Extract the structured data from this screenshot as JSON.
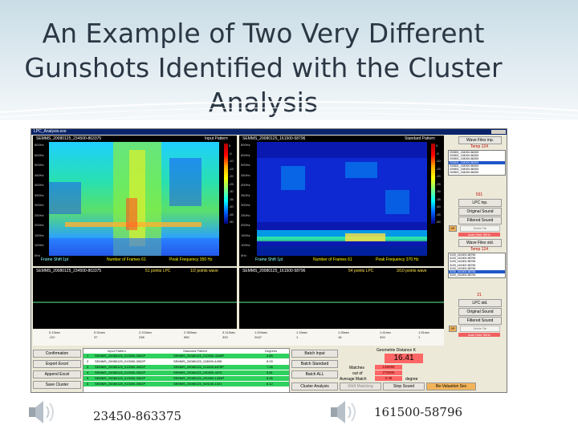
{
  "slide": {
    "title": "An Example of Two Very Different\nGunshots Identified with the Cluster\nAnalysis",
    "caption_left": "23450-863375",
    "caption_right": "161500-58796"
  },
  "window": {
    "title": "LPC_Analysis.exe",
    "input_pane": {
      "file": "SEMMS_20080125_234500-863375",
      "label": "Input Pattern",
      "freq_ticks": [
        "800Hz",
        "600Hz",
        "500Hz",
        "450Hz",
        "400Hz",
        "350Hz",
        "300Hz",
        "250Hz",
        "200Hz",
        "150Hz",
        "100Hz",
        "0Hz"
      ],
      "footer_frame": "Frame Shift 1pt",
      "footer_frames": "Number of Frames 61",
      "footer_peak": "Peak Frequency 350 Hz"
    },
    "standard_pane": {
      "file": "SEMMS_20080125_161500-58796",
      "label": "Standard Pattern",
      "freq_ticks": [
        "800Hz",
        "600Hz",
        "500Hz",
        "450Hz",
        "400Hz",
        "350Hz",
        "300Hz",
        "250Hz",
        "200Hz",
        "150Hz",
        "100Hz",
        "0Hz"
      ],
      "footer_frame": "Frame Shift 1pt",
      "footer_frames": "Number of Frames 61",
      "footer_peak": "Peak Frequency 370 Hz"
    },
    "colorbar_ticks": [
      "0",
      "-5",
      "-10",
      "-15",
      "-20",
      "-25",
      "-30",
      "-35",
      "-40",
      "-45",
      "-50"
    ],
    "wave_left": {
      "file": "SEMMS_20080125_234500-863375",
      "points": "51 points LPC",
      "mode": "1/2 points wave",
      "ticks": [
        "0.13sec",
        "0.91sec",
        "2.113sec",
        "2.350sec",
        "3.113sec"
      ],
      "sub": [
        "-22+",
        "37",
        "238",
        "550",
        "320"
      ]
    },
    "wave_right": {
      "file": "SEMMS_20080125_161500-58796",
      "points": "54 points LPC",
      "mode": "3/10 points wave",
      "ticks": [
        "1.024sec",
        "1.15sec",
        "1.26sec",
        "1.41sec",
        "1.51sec"
      ],
      "sub": [
        "2047",
        "1",
        "16",
        "320",
        "1"
      ]
    },
    "right_panel": {
      "wave_files_inp": "Wave Files inp.",
      "temp_inp": "Temp 124",
      "files_inp": [
        "200801_154000-86305",
        "200801_154000-86305",
        "200801_154000-86305",
        "200801_154000-86305",
        "200801_154000-86305",
        "200801_154000-86305",
        "200801_154000-86305"
      ],
      "num_inp": "531",
      "lpc_inp": "LPC inp.",
      "original_sound": "Original Sound",
      "filtered_sound": "Filtered Sound",
      "delete_file": "Delete File",
      "auto": "Auto",
      "hide": "Hide",
      "hz": "50Hz",
      "wave_files_std": "Wave Files std.",
      "temp_std": "Temp 124",
      "files_std": [
        "3100_161500-58796",
        "3100_161500-58796",
        "3100_161500-58796",
        "3100_161500-58796",
        "3100_161500-58796",
        "3100_161500-58796",
        "3100_161500-58796"
      ],
      "num_std": "21",
      "lpc_std": "LPC std.",
      "original_sound_2": "Original Sound",
      "filtered_sound_2": "Filtered Sound",
      "delete_file_2": "Delete File",
      "auto_2": "Auto",
      "hide_2": "Hide",
      "hz_2": "50Hz",
      "small_btn": "DR",
      "small_btn_2": "DR"
    },
    "bottom": {
      "buttons_left": [
        "Confirmation",
        "Export Excel",
        "Append Excel",
        "Save Cluster"
      ],
      "table_headers": [
        "Input Pattern",
        "Standard Pattern",
        "Degrees"
      ],
      "rows": [
        {
          "n": "1",
          "input": "SEMMS_20080125_013000-3002P",
          "std": "SEMMS_20080125_210000-4108P",
          "deg": "4.89"
        },
        {
          "n": "2",
          "input": "SEMMS_20080125_013000-3002P",
          "std": "SEMMS_20080125_115000-4455",
          "deg": "5.03"
        },
        {
          "n": "3",
          "input": "SEMMS_20080125_013000-3002P",
          "std": "SEMMS_20080125_211500-4876P",
          "deg": "7.26"
        },
        {
          "n": "4",
          "input": "SEMMS_20080125_013000-3002P",
          "std": "SEMMS_20080125_230500-4376",
          "deg": "5.81"
        },
        {
          "n": "5",
          "input": "SEMMS_20080125_013000-3002P",
          "std": "SEMMS_20080125_230000-1336P",
          "deg": "6.05"
        },
        {
          "n": "6",
          "input": "SEMMS_20080125_013000-3002P",
          "std": "SEMMS_20080125_003130-1021",
          "deg": "6.12"
        }
      ],
      "batch_input": "Batch Input",
      "batch_standard": "Batch Standard",
      "batch_all": "Batch ALL",
      "cluster_analysis": "Cluster Analysis",
      "shift_matching": "Shift Matching",
      "stop_sound": "Stop Sound",
      "re_valuation": "Re-Valuation Sec",
      "geo_title": "Geometrie Distance K",
      "geo_value": "16.41",
      "matches_label": "Matches",
      "matches_val": "136089",
      "outof_label": "out of",
      "outof_val": "275005",
      "avg_label": "Average Match",
      "avg_val": "0.38",
      "degree": "degree"
    }
  },
  "colors": {
    "title_text": "#2b3744",
    "accent_red": "#ff6666",
    "table_green": "#2fd15e"
  }
}
